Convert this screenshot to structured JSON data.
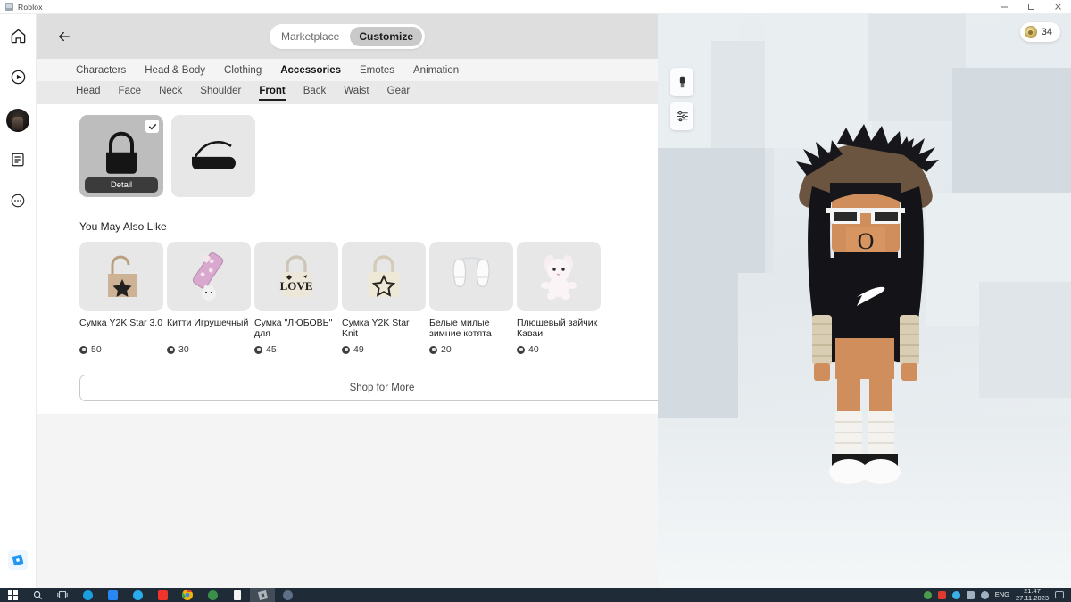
{
  "window": {
    "title": "Roblox",
    "minimize_label": "Minimize",
    "maximize_label": "Maximize",
    "close_label": "Close"
  },
  "rail": {
    "items": [
      {
        "name": "home-icon",
        "label": "Home"
      },
      {
        "name": "play-icon",
        "label": "Discover"
      },
      {
        "name": "avatar-icon",
        "label": "Avatar"
      },
      {
        "name": "list-icon",
        "label": "Inventory"
      },
      {
        "name": "more-icon",
        "label": "More"
      }
    ],
    "bottom_logo": "roblox-logo"
  },
  "header": {
    "back_label": "Back",
    "segments": [
      {
        "label": "Marketplace",
        "active": false
      },
      {
        "label": "Customize",
        "active": true
      }
    ]
  },
  "main_tabs": [
    {
      "label": "Characters",
      "active": false
    },
    {
      "label": "Head & Body",
      "active": false
    },
    {
      "label": "Clothing",
      "active": false
    },
    {
      "label": "Accessories",
      "active": true
    },
    {
      "label": "Emotes",
      "active": false
    },
    {
      "label": "Animation",
      "active": false
    }
  ],
  "sub_tabs": [
    {
      "label": "Head",
      "active": false
    },
    {
      "label": "Face",
      "active": false
    },
    {
      "label": "Neck",
      "active": false
    },
    {
      "label": "Shoulder",
      "active": false
    },
    {
      "label": "Front",
      "active": true
    },
    {
      "label": "Back",
      "active": false
    },
    {
      "label": "Waist",
      "active": false
    },
    {
      "label": "Gear",
      "active": false
    }
  ],
  "owned_items": [
    {
      "name": "tote-bag-thumb",
      "selected": true,
      "badge": "Detail",
      "checked": true
    },
    {
      "name": "duffel-bag-thumb",
      "selected": false,
      "badge": "",
      "checked": false
    }
  ],
  "recommendations": {
    "title": "You May Also Like",
    "items": [
      {
        "name": "Сумка Y2K Star 3.0",
        "price": "50",
        "thumb": "star-tote-tan"
      },
      {
        "name": "Китти Игрушечный",
        "price": "30",
        "thumb": "kitty-toy-pink"
      },
      {
        "name": "Сумка \"ЛЮБОВЬ\" для",
        "price": "45",
        "thumb": "love-tote-cream"
      },
      {
        "name": "Сумка Y2K Star Knit",
        "price": "49",
        "thumb": "star-knit-tote"
      },
      {
        "name": "Белые милые зимние котята",
        "price": "20",
        "thumb": "white-mittens"
      },
      {
        "name": "Плюшевый зайчик Каваи",
        "price": "40",
        "thumb": "plush-bunny"
      }
    ],
    "shop_button": "Shop for More"
  },
  "viewport": {
    "camera_button": "camera-icon",
    "settings_button": "sliders-icon",
    "robux_balance": "34"
  },
  "taskbar": {
    "apps": [
      {
        "name": "start-button",
        "color": "#ffffff"
      },
      {
        "name": "search-icon",
        "color": "#dfe6ec"
      },
      {
        "name": "task-view-icon",
        "color": "#dfe6ec"
      },
      {
        "name": "steam-icon",
        "color": "#1b9ee0"
      },
      {
        "name": "vk-icon",
        "color": "#2787f5"
      },
      {
        "name": "telegram-icon",
        "color": "#2aabee"
      },
      {
        "name": "red-app-icon",
        "color": "#f0342c"
      },
      {
        "name": "chrome-icon",
        "color": "#4285f4"
      },
      {
        "name": "green-app-icon",
        "color": "#3a8f49"
      },
      {
        "name": "document-icon",
        "color": "#f5f5f5"
      },
      {
        "name": "roblox-icon",
        "color": "#a7aeb5",
        "active": true
      },
      {
        "name": "paint-icon",
        "color": "#5d6f86"
      }
    ],
    "tray": {
      "language": "ENG",
      "time": "21:47",
      "date": "27.11.2023"
    }
  }
}
